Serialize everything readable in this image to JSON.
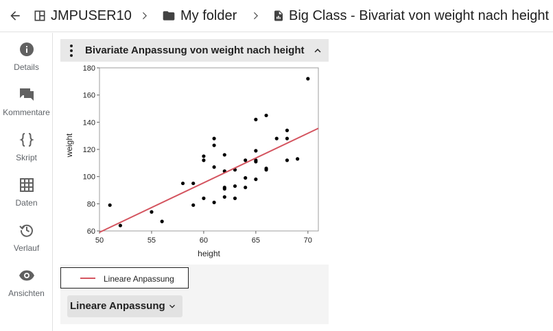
{
  "breadcrumb": {
    "items": [
      {
        "label": "JMPUSER10",
        "icon": "dashboard-icon"
      },
      {
        "label": "My folder",
        "icon": "folder-icon"
      },
      {
        "label": "Big Class - Bivariat von weight nach height",
        "icon": "report-file-icon"
      }
    ]
  },
  "sidebar": {
    "items": [
      {
        "label": "Details",
        "icon": "info-icon"
      },
      {
        "label": "Kommentare",
        "icon": "comment-icon"
      },
      {
        "label": "Skript",
        "icon": "code-braces-icon"
      },
      {
        "label": "Daten",
        "icon": "table-icon"
      },
      {
        "label": "Verlauf",
        "icon": "history-icon"
      },
      {
        "label": "Ansichten",
        "icon": "eye-icon"
      }
    ]
  },
  "panel": {
    "title": "Bivariate Anpassung von weight nach height",
    "fit_button_label": "Lineare Anpassung"
  },
  "legend": {
    "label": "Lineare Anpassung"
  },
  "colors": {
    "fit_line": "#d4545f",
    "points": "#000000"
  },
  "chart_data": {
    "type": "scatter",
    "xlabel": "height",
    "ylabel": "weight",
    "xlim": [
      50,
      71
    ],
    "ylim": [
      60,
      180
    ],
    "xticks": [
      50,
      55,
      60,
      65,
      70
    ],
    "yticks": [
      60,
      80,
      100,
      120,
      140,
      160,
      180
    ],
    "grid": false,
    "points": [
      [
        51,
        79
      ],
      [
        52,
        64
      ],
      [
        55,
        74
      ],
      [
        56,
        67
      ],
      [
        58,
        95
      ],
      [
        59,
        79
      ],
      [
        59,
        95
      ],
      [
        60,
        84
      ],
      [
        60,
        112
      ],
      [
        60,
        115
      ],
      [
        61,
        81
      ],
      [
        61,
        107
      ],
      [
        61,
        123
      ],
      [
        61,
        128
      ],
      [
        62,
        85
      ],
      [
        62,
        91
      ],
      [
        62,
        92
      ],
      [
        62,
        104
      ],
      [
        62,
        116
      ],
      [
        63,
        84
      ],
      [
        63,
        93
      ],
      [
        63,
        105
      ],
      [
        64,
        92
      ],
      [
        64,
        99
      ],
      [
        64,
        112
      ],
      [
        65,
        98
      ],
      [
        65,
        111
      ],
      [
        65,
        112
      ],
      [
        65,
        119
      ],
      [
        65,
        142
      ],
      [
        66,
        105
      ],
      [
        66,
        106
      ],
      [
        66,
        145
      ],
      [
        67,
        128
      ],
      [
        68,
        112
      ],
      [
        68,
        128
      ],
      [
        68,
        134
      ],
      [
        69,
        113
      ],
      [
        70,
        172
      ]
    ],
    "fit_line": {
      "name": "Lineare Anpassung",
      "x": [
        50,
        71
      ],
      "y": [
        59,
        135.5
      ]
    }
  }
}
